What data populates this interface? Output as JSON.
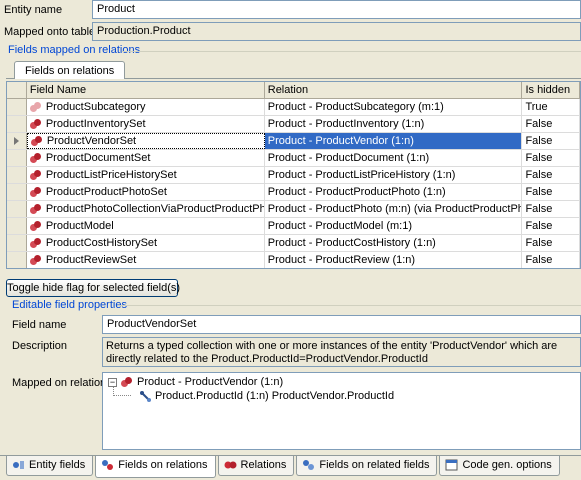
{
  "entity": {
    "name_label": "Entity name",
    "name_value": "Product",
    "mapped_label": "Mapped onto table",
    "mapped_value": "Production.Product"
  },
  "fields_group": {
    "title": "Fields mapped on relations",
    "tab_label": "Fields on relations",
    "columns": [
      "Field Name",
      "Relation",
      "Is hidden"
    ],
    "rows": [
      {
        "field": "ProductSubcategory",
        "relation": "Product - ProductSubcategory (m:1)",
        "hidden": "True",
        "faded": true
      },
      {
        "field": "ProductInventorySet",
        "relation": "Product - ProductInventory (1:n)",
        "hidden": "False"
      },
      {
        "field": "ProductVendorSet",
        "relation": "Product - ProductVendor (1:n)",
        "hidden": "False",
        "selected": true
      },
      {
        "field": "ProductDocumentSet",
        "relation": "Product - ProductDocument (1:n)",
        "hidden": "False"
      },
      {
        "field": "ProductListPriceHistorySet",
        "relation": "Product - ProductListPriceHistory (1:n)",
        "hidden": "False"
      },
      {
        "field": "ProductProductPhotoSet",
        "relation": "Product - ProductProductPhoto (1:n)",
        "hidden": "False"
      },
      {
        "field": "ProductPhotoCollectionViaProductProductPhoto",
        "relation": "Product - ProductPhoto (m:n) (via ProductProductPhoto)",
        "hidden": "False"
      },
      {
        "field": "ProductModel",
        "relation": "Product - ProductModel (m:1)",
        "hidden": "False"
      },
      {
        "field": "ProductCostHistorySet",
        "relation": "Product - ProductCostHistory (1:n)",
        "hidden": "False"
      },
      {
        "field": "ProductReviewSet",
        "relation": "Product - ProductReview (1:n)",
        "hidden": "False"
      }
    ],
    "toggle_button": "Toggle hide flag for selected field(s)"
  },
  "editable": {
    "title": "Editable field properties",
    "field_name_label": "Field name",
    "field_name_value": "ProductVendorSet",
    "description_label": "Description",
    "description_value": "Returns a typed collection with one or more instances of the entity 'ProductVendor' which are directly related to the Product.ProductId=ProductVendor.ProductId",
    "mapped_label": "Mapped on relation",
    "tree_root": "Product - ProductVendor (1:n)",
    "tree_child": "Product.ProductId (1:n) ProductVendor.ProductId"
  },
  "bottom_tabs": [
    {
      "label": "Entity fields",
      "icon": "entity-fields-icon"
    },
    {
      "label": "Fields on relations",
      "icon": "fields-on-relations-icon",
      "active": true
    },
    {
      "label": "Relations",
      "icon": "relations-icon"
    },
    {
      "label": "Fields on related fields",
      "icon": "related-fields-icon"
    },
    {
      "label": "Code gen. options",
      "icon": "code-gen-icon"
    }
  ],
  "colors": {
    "selection": "#316ac5",
    "group_title": "#0046d5",
    "entity_red": "#cc2a36"
  }
}
